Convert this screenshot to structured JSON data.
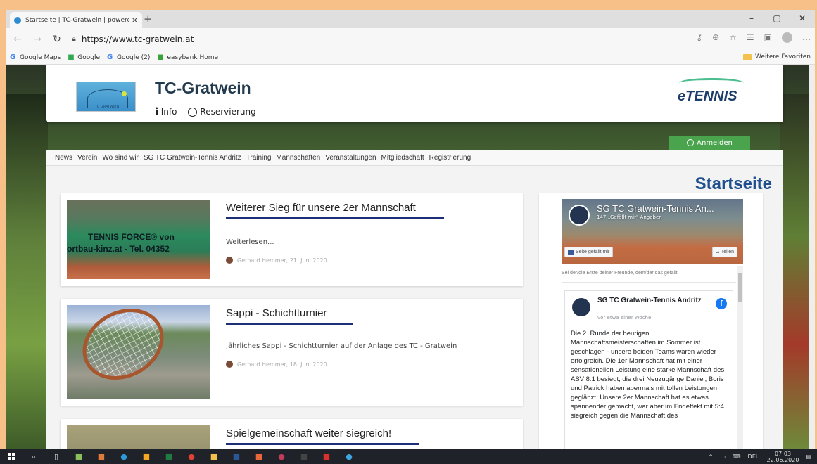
{
  "browser": {
    "tab_title": "Startseite | TC-Gratwein | powere",
    "tab_close": "×",
    "new_tab": "+",
    "url": "https://www.tc-gratwein.at",
    "window_controls": [
      "–",
      "▢",
      "✕"
    ],
    "favorites": [
      {
        "label": "Google Maps",
        "icon": "G",
        "color": "#4285f4"
      },
      {
        "label": "Google",
        "icon": "■",
        "color": "#34a853"
      },
      {
        "label": "Google (2)",
        "icon": "G",
        "color": "#4285f4"
      },
      {
        "label": "easybank Home",
        "icon": "■",
        "color": "#3aa23a"
      }
    ],
    "favorites_more": "Weitere Favoriten"
  },
  "site": {
    "title": "TC-Gratwein",
    "logo_text": "TC GRATWEIN",
    "header_links": [
      "Info",
      "Reservierung"
    ],
    "partner_logo": "eTENNIS",
    "login_label": "Anmelden",
    "nav": [
      "News",
      "Verein",
      "Wo sind wir",
      "SG TC Gratwein-Tennis Andritz",
      "Training",
      "Mannschaften",
      "Veranstaltungen",
      "Mitgliedschaft",
      "Registrierung"
    ],
    "page_title": "Startseite",
    "colors": {
      "brand_blue": "#1f4f8e",
      "login_green": "#4aa44e",
      "underline": "#1d2f7a"
    }
  },
  "posts": [
    {
      "title": "Weiterer Sieg für unsere 2er Mannschaft",
      "excerpt": "Weiterlesen...",
      "meta": "Gerhard Hemmer, 21. Juni 2020",
      "image_text_1": "TENNIS FORCE® von",
      "image_text_2": "ortbau-kinz.at - Tel. 04352"
    },
    {
      "title": "Sappi - Schichtturnier",
      "excerpt": "Jährliches Sappi - Schichtturnier auf der Anlage des TC - Gratwein",
      "meta": "Gerhard Hemmer, 18. Juni 2020"
    },
    {
      "title": "Spielgemeinschaft weiter siegreich!"
    }
  ],
  "facebook": {
    "page_name": "SG TC Gratwein-Tennis An...",
    "likes": "147 „Gefällt mir\"-Angaben",
    "like_button": "Seite gefällt mir",
    "share_button": "Teilen",
    "friends_text": "Sei der/die Erste deiner Freunde, dem/der das gefällt",
    "post_author": "SG TC Gratwein-Tennis Andritz",
    "post_time": "vor etwa einer Woche",
    "post_logo": "f",
    "post_body": "Die 2. Runde der heurigen Mannschaftsmeisterschaften im Sommer ist geschlagen - unsere beiden Teams waren wieder erfolgreich. Die 1er Mannschaft hat mit einer sensationellen Leistung eine starke Mannschaft des ASV 8:1 besiegt, die drei Neuzugänge Daniel, Boris und Patrick haben abermals mit tollen Leistungen geglänzt. Unsere 2er Mannschaft hat es etwas spannender gemacht, war aber im Endeffekt mit 5:4 siegreich gegen die Mannschaft des"
  },
  "taskbar": {
    "language": "DEU",
    "time": "07:03",
    "date": "22.06.2020",
    "apps": [
      {
        "name": "search-icon",
        "glyph": "⌕",
        "color": "#dddddd"
      },
      {
        "name": "task-view-icon",
        "glyph": "▯",
        "color": "#dddddd"
      },
      {
        "name": "app-icon",
        "glyph": "■",
        "color": "#8bbf5a"
      },
      {
        "name": "photoshop-icon",
        "glyph": "■",
        "color": "#e07b3a"
      },
      {
        "name": "edge-icon",
        "glyph": "●",
        "color": "#2d9ad8"
      },
      {
        "name": "media-icon",
        "glyph": "■",
        "color": "#f5a623"
      },
      {
        "name": "excel-icon",
        "glyph": "■",
        "color": "#1f7a44"
      },
      {
        "name": "chrome-icon",
        "glyph": "●",
        "color": "#e34133"
      },
      {
        "name": "explorer-icon",
        "glyph": "■",
        "color": "#f2c14e"
      },
      {
        "name": "word-icon",
        "glyph": "■",
        "color": "#2b5797"
      },
      {
        "name": "app2-icon",
        "glyph": "■",
        "color": "#e8683a"
      },
      {
        "name": "app3-icon",
        "glyph": "●",
        "color": "#c23c5c"
      },
      {
        "name": "app4-icon",
        "glyph": "■",
        "color": "#444444"
      },
      {
        "name": "mail-icon",
        "glyph": "■",
        "color": "#d8322b"
      },
      {
        "name": "app5-icon",
        "glyph": "●",
        "color": "#3fa5e0"
      }
    ]
  }
}
